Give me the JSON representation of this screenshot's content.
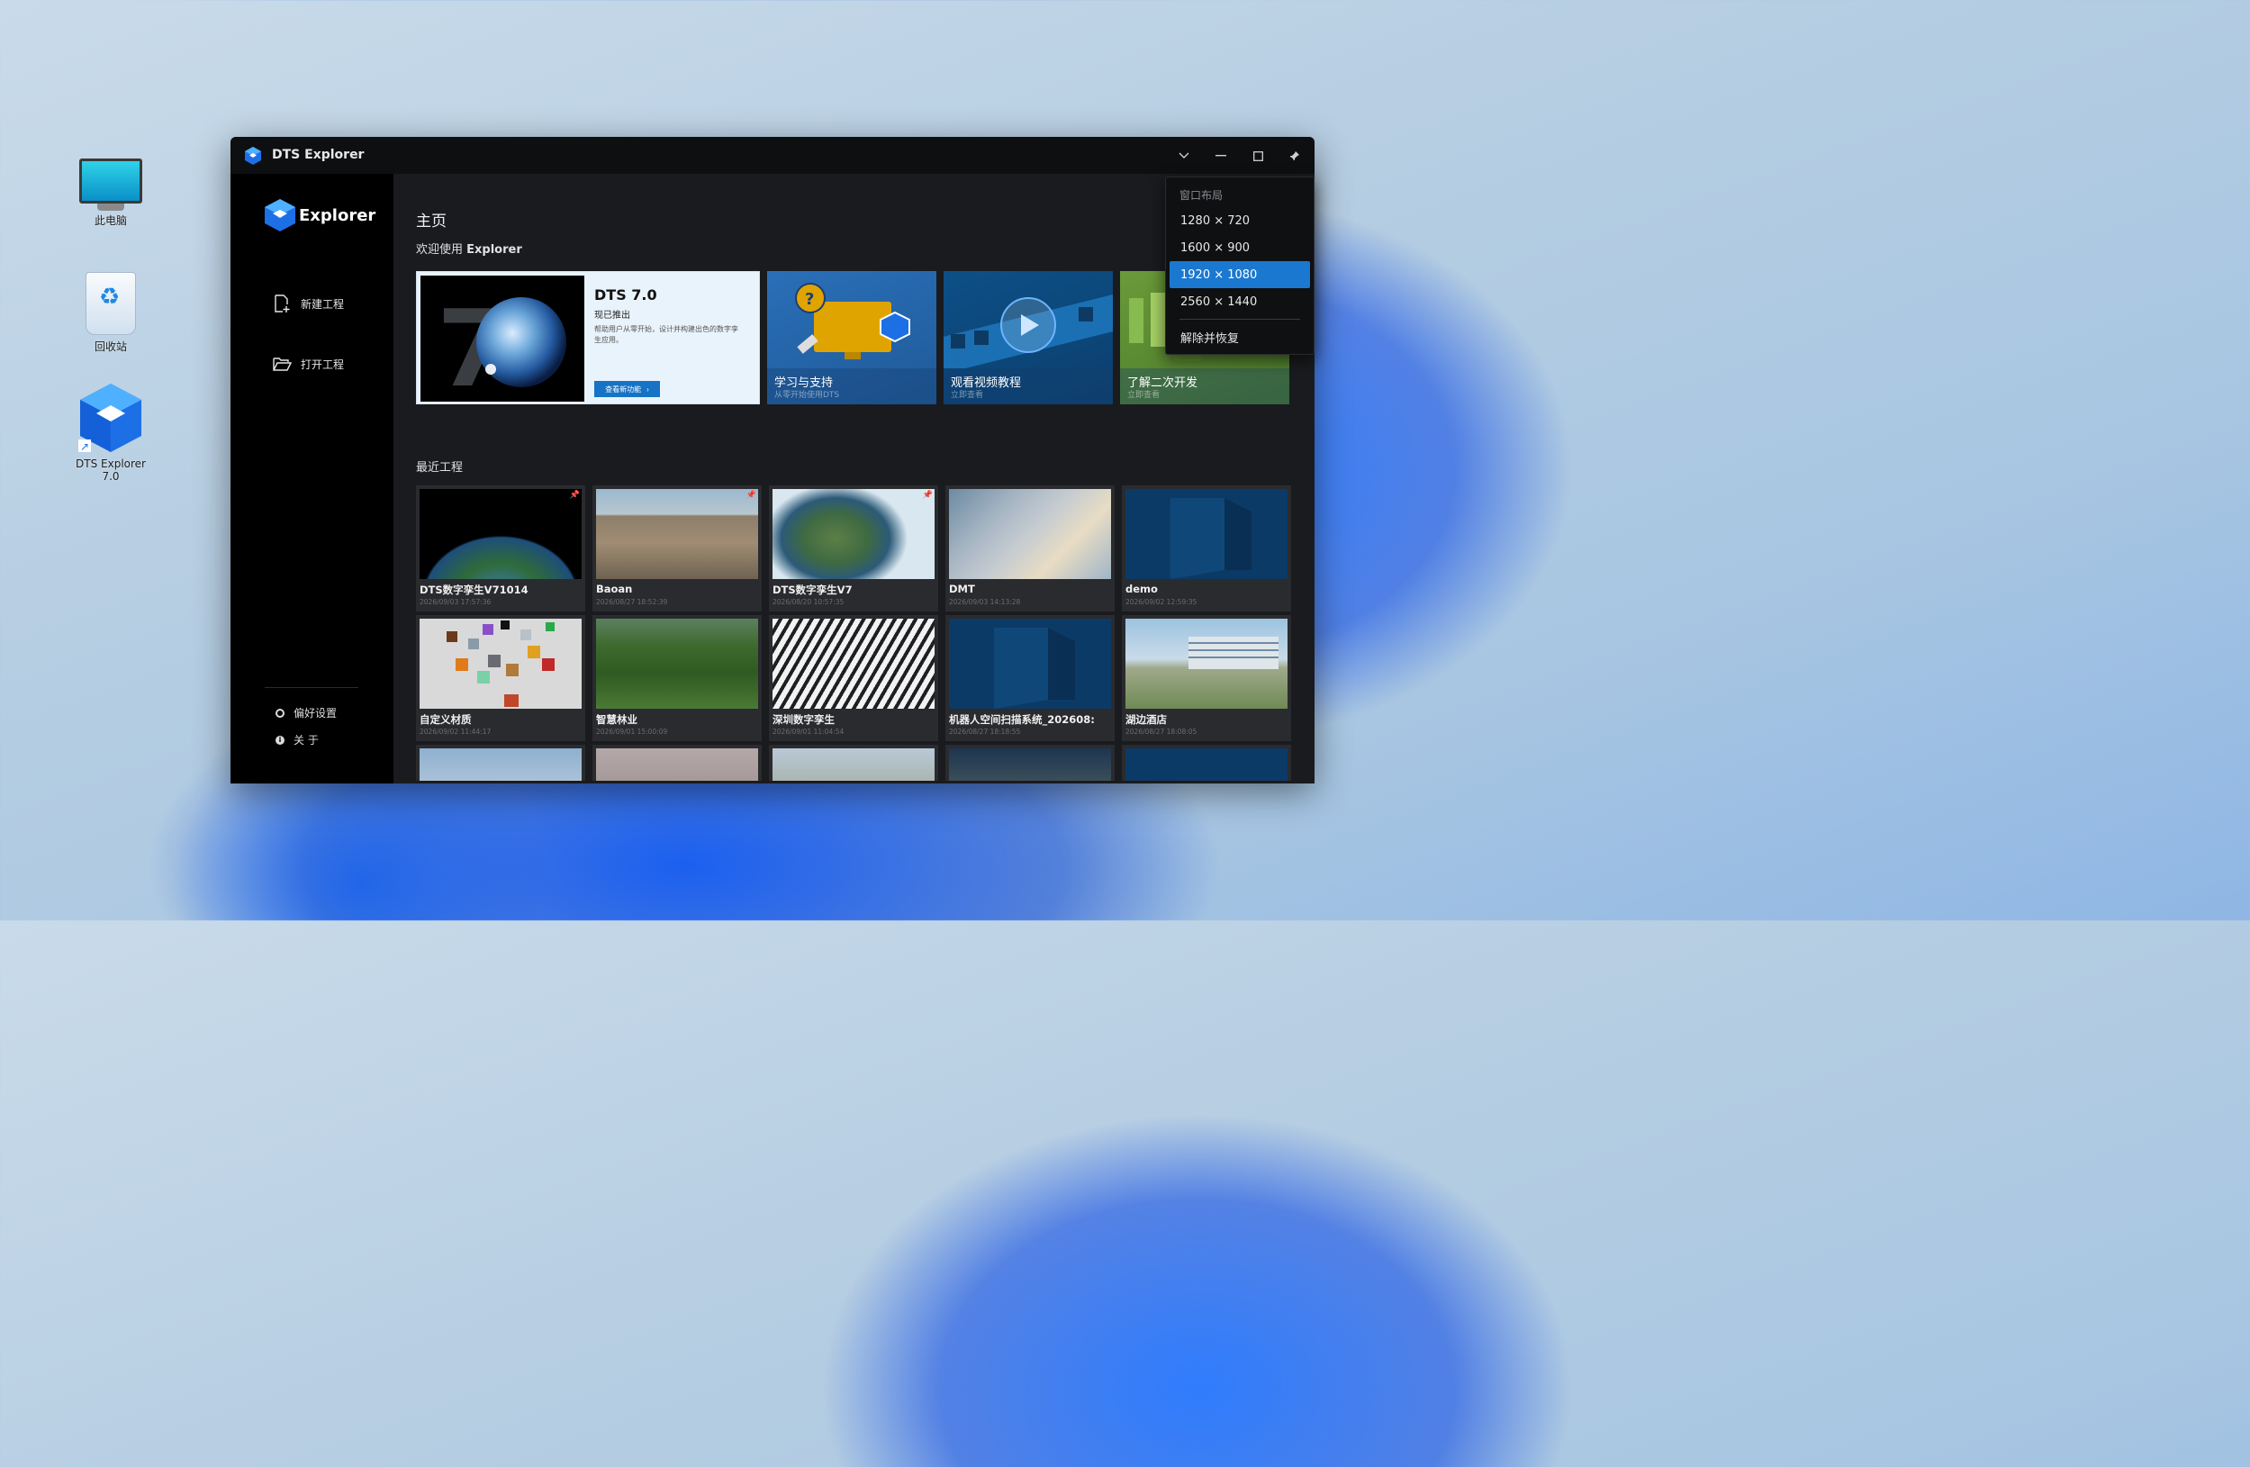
{
  "desktop": {
    "icons": [
      {
        "label": "此电脑"
      },
      {
        "label": "回收站"
      },
      {
        "label": "DTS Explorer 7.0"
      }
    ]
  },
  "window": {
    "title": "DTS Explorer",
    "controls": {
      "collapse": "chevron-down-icon",
      "minimize": "minimize-icon",
      "maximize": "maximize-icon",
      "pin": "pin-icon"
    }
  },
  "sidebar": {
    "brand": "Explorer",
    "nav": [
      {
        "label": "新建工程",
        "icon": "new-file-icon"
      },
      {
        "label": "打开工程",
        "icon": "folder-open-icon"
      }
    ],
    "bottom": [
      {
        "label": "偏好设置",
        "icon": "settings-icon"
      },
      {
        "label": "关 于",
        "icon": "info-icon"
      }
    ]
  },
  "main": {
    "title": "主页",
    "welcome_prefix": "欢迎使用 ",
    "welcome_name": "Explorer",
    "feature": {
      "version": "DTS 7.0",
      "subtitle": "现已推出",
      "desc": "帮助用户从零开始，设计并构建出色的数字孪生应用。",
      "button": "查看新功能",
      "big_digit": "7"
    },
    "tiles": [
      {
        "title": "学习与支持",
        "sub": "从零开始使用DTS"
      },
      {
        "title": "观看视频教程",
        "sub": "立即查看"
      },
      {
        "title": "了解二次开发",
        "sub": "立即查看"
      }
    ],
    "recent_title": "最近工程",
    "recent": [
      {
        "name": "DTS数字孪生V71014",
        "date": "2026/09/03 17:57:36",
        "pinned": true
      },
      {
        "name": "Baoan",
        "date": "2026/08/27 18:52:39",
        "pinned": true
      },
      {
        "name": "DTS数字孪生V7",
        "date": "2026/08/20 10:57:35",
        "pinned": true
      },
      {
        "name": "DMT",
        "date": "2026/09/03 14:13:28",
        "pinned": false
      },
      {
        "name": "demo",
        "date": "2026/09/02 12:59:35",
        "pinned": false
      },
      {
        "name": "自定义材质",
        "date": "2026/09/02 11:44:17",
        "pinned": false
      },
      {
        "name": "智慧林业",
        "date": "2026/09/01 15:00:09",
        "pinned": false
      },
      {
        "name": "深圳数字孪生",
        "date": "2026/09/01 11:04:54",
        "pinned": false
      },
      {
        "name": "机器人空间扫描系统_202608:",
        "date": "2026/08/27 18:18:55",
        "pinned": false
      },
      {
        "name": "湖边酒店",
        "date": "2026/08/27 18:08:05",
        "pinned": false
      }
    ]
  },
  "dropdown": {
    "header": "窗口布局",
    "options": [
      "1280 × 720",
      "1600 × 900",
      "1920 × 1080",
      "2560 × 1440"
    ],
    "selected": "1920 × 1080",
    "action": "解除并恢复"
  },
  "colors": {
    "accent": "#1a78d0",
    "window_bg": "#18191c",
    "sidebar_bg": "#000000",
    "titlebar_bg": "#0e0f11",
    "card_bg": "#2a2b2e"
  }
}
